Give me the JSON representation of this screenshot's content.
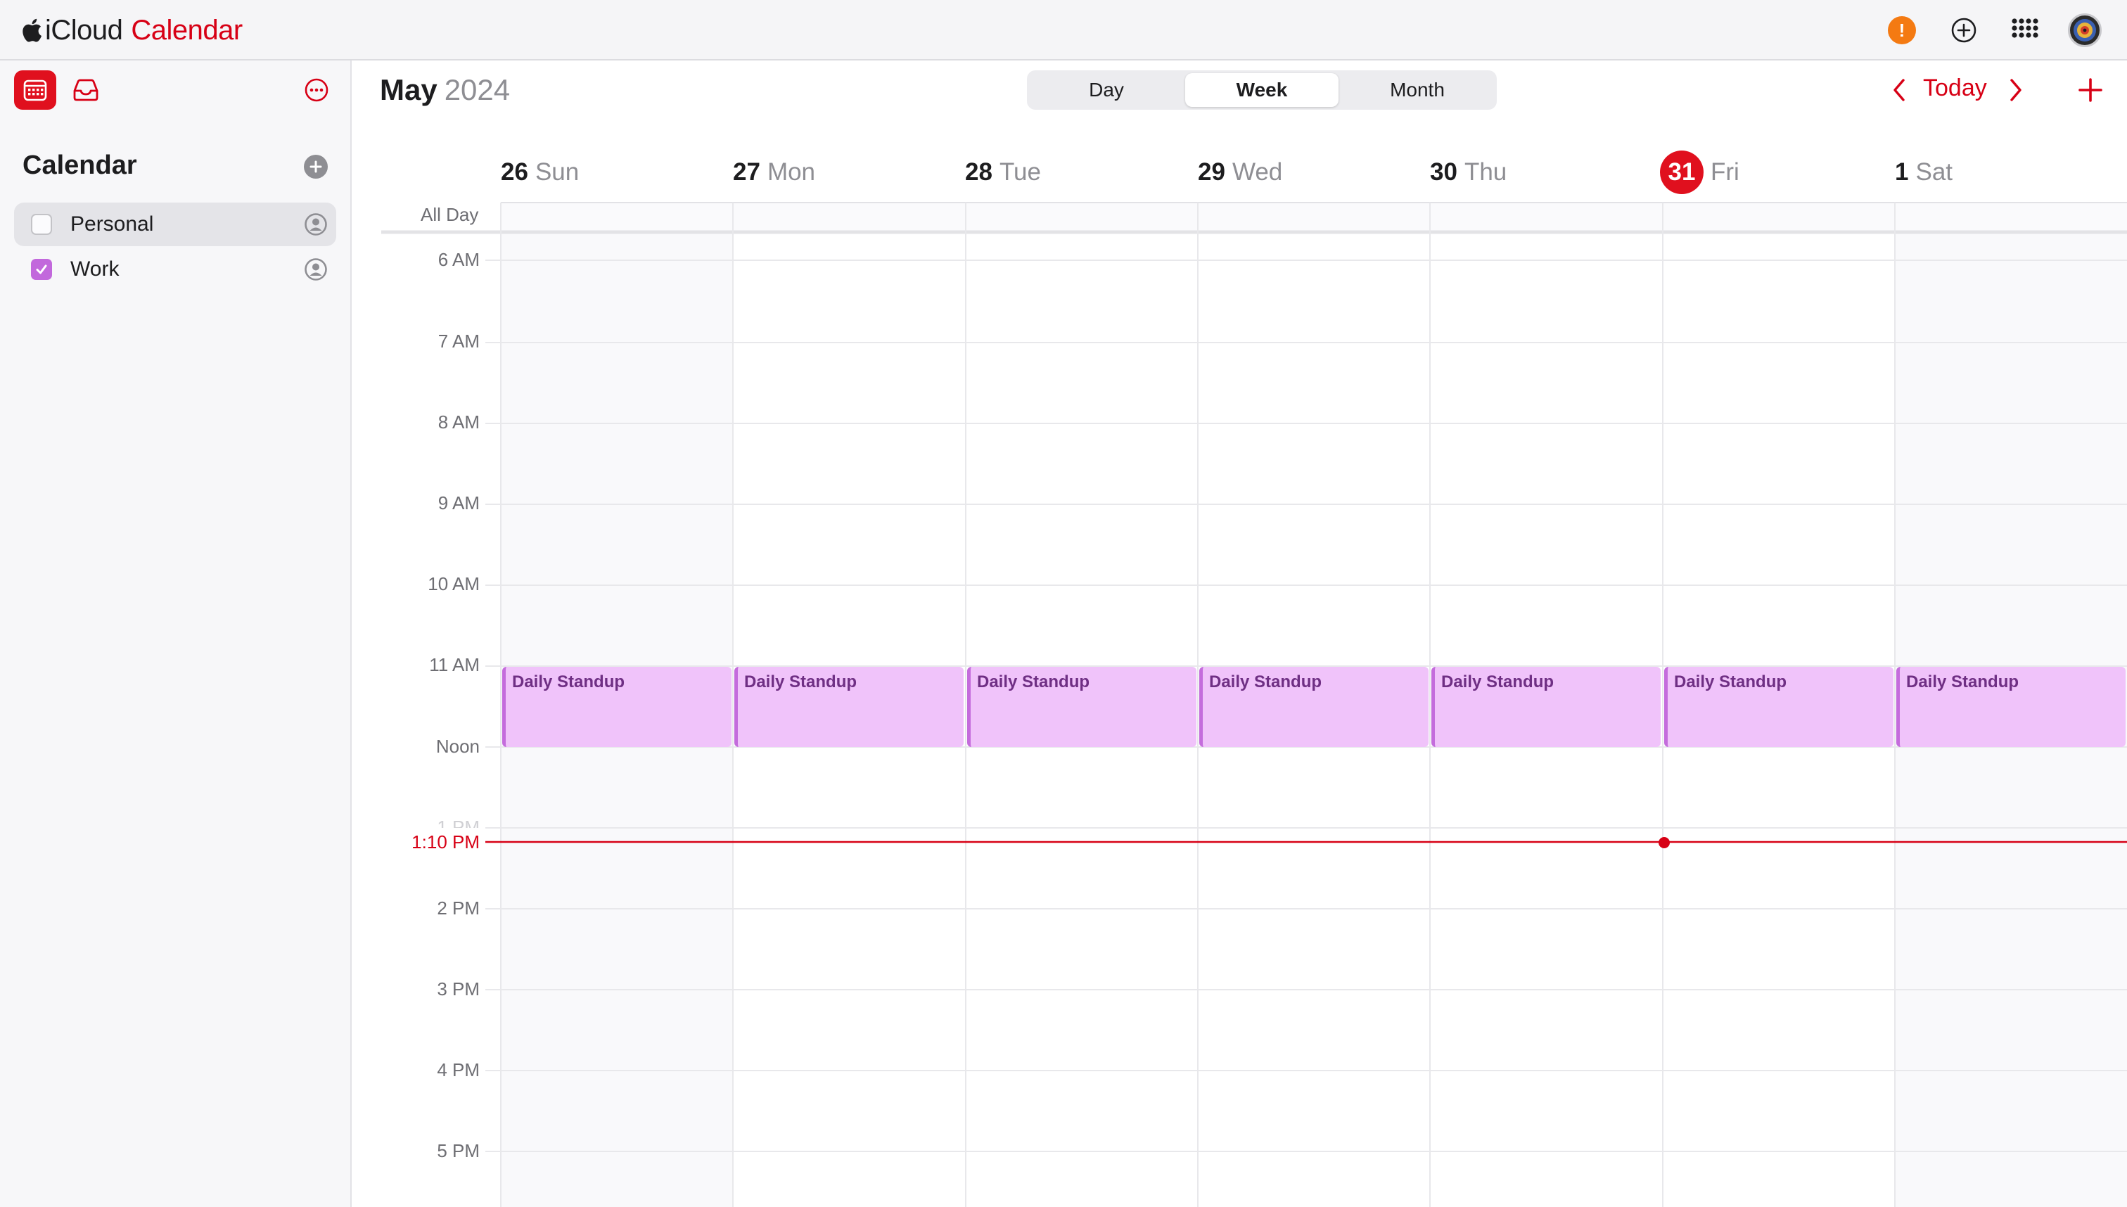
{
  "topbar": {
    "brand_product": "iCloud",
    "brand_app": "Calendar",
    "alert_mark": "!",
    "icons": [
      "apple-logo-icon",
      "alert-icon",
      "add-circle-icon",
      "app-grid-icon",
      "account-avatar"
    ]
  },
  "sidebar": {
    "title": "Calendar",
    "calendars": [
      {
        "label": "Personal",
        "checked": false
      },
      {
        "label": "Work",
        "checked": true,
        "color": "#c268dc"
      }
    ]
  },
  "header": {
    "month": "May",
    "year": "2024",
    "view_tabs": [
      {
        "label": "Day",
        "active": false
      },
      {
        "label": "Week",
        "active": true
      },
      {
        "label": "Month",
        "active": false
      }
    ],
    "today_label": "Today"
  },
  "week": {
    "days": [
      {
        "num": "26",
        "dow": "Sun",
        "today": false
      },
      {
        "num": "27",
        "dow": "Mon",
        "today": false
      },
      {
        "num": "28",
        "dow": "Tue",
        "today": false
      },
      {
        "num": "29",
        "dow": "Wed",
        "today": false
      },
      {
        "num": "30",
        "dow": "Thu",
        "today": false
      },
      {
        "num": "31",
        "dow": "Fri",
        "today": true
      },
      {
        "num": "1",
        "dow": "Sat",
        "today": false
      }
    ],
    "all_day_label": "All Day",
    "hours": [
      "6 AM",
      "7 AM",
      "8 AM",
      "9 AM",
      "10 AM",
      "11 AM",
      "Noon",
      "1 PM",
      "2 PM",
      "3 PM",
      "4 PM",
      "5 PM"
    ],
    "current_time": "1:10 PM",
    "events": [
      {
        "title": "Daily Standup",
        "day": 0
      },
      {
        "title": "Daily Standup",
        "day": 1
      },
      {
        "title": "Daily Standup",
        "day": 2
      },
      {
        "title": "Daily Standup",
        "day": 3
      },
      {
        "title": "Daily Standup",
        "day": 4
      },
      {
        "title": "Daily Standup",
        "day": 5
      },
      {
        "title": "Daily Standup",
        "day": 6
      }
    ]
  },
  "colors": {
    "accent": "#d70015",
    "today_circle": "#e0101e",
    "event_fill": "#f0c3fa",
    "event_border": "#c46cdc",
    "alert": "#f47a12"
  }
}
